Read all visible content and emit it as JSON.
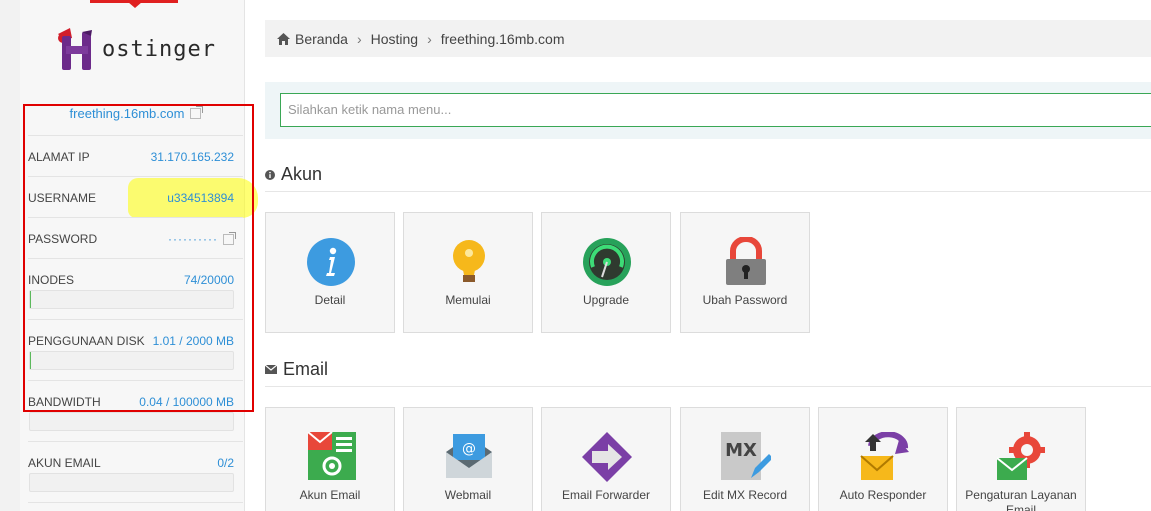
{
  "brand": {
    "logo_text": "ostinger"
  },
  "sidebar": {
    "domain": "freething.16mb.com",
    "rows": {
      "ip": {
        "label": "ALAMAT IP",
        "value": "31.170.165.232"
      },
      "username": {
        "label": "USERNAME",
        "value": "u334513894"
      },
      "password": {
        "label": "PASSWORD",
        "value": "··········"
      },
      "inodes": {
        "label": "INODES",
        "value": "74/20000",
        "usage": 0.0037
      },
      "disk": {
        "label": "PENGGUNAAN DISK",
        "value": "1.01 / 2000 MB",
        "usage": 0.0005
      },
      "bandwidth": {
        "label": "BANDWIDTH",
        "value": "0.04 / 100000 MB",
        "usage": 0.0
      },
      "email": {
        "label": "AKUN EMAIL",
        "value": "0/2",
        "usage": 0.0
      }
    }
  },
  "breadcrumb": {
    "home": "Beranda",
    "level1": "Hosting",
    "level2": "freething.16mb.com"
  },
  "search": {
    "placeholder": "Silahkan ketik nama menu..."
  },
  "sections": {
    "akun": {
      "title": "Akun",
      "tiles": [
        "Detail",
        "Memulai",
        "Upgrade",
        "Ubah Password"
      ]
    },
    "email": {
      "title": "Email",
      "tiles": [
        "Akun Email",
        "Webmail",
        "Email Forwarder",
        "Edit MX Record",
        "Auto Responder",
        "Pengaturan Layanan Email"
      ]
    }
  },
  "colors": {
    "accent": "#2e8fd6",
    "success": "#3aa755",
    "annotation_red": "#e00000",
    "annotation_yellow": "#ffff00"
  },
  "icons": {
    "info": "info-icon",
    "bulb": "lightbulb-icon",
    "gauge": "speedometer-icon",
    "lock": "padlock-icon",
    "email_accounts": "email-accounts-icon",
    "webmail": "webmail-icon",
    "forwarder": "forward-arrow-icon",
    "mx": "mx-record-edit-icon",
    "responder": "auto-responder-icon",
    "email_settings": "email-settings-icon"
  }
}
